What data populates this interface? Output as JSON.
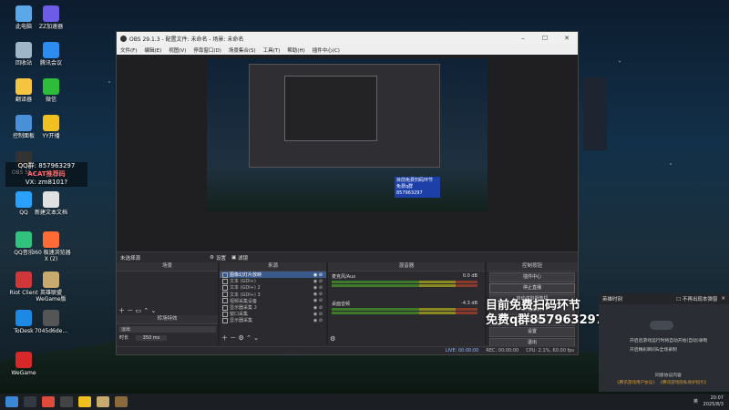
{
  "desktop_icons": [
    {
      "label": "此电脑",
      "color": "#5ba7e8"
    },
    {
      "label": "ZZ加速器",
      "color": "#6c5ce7"
    },
    {
      "label": "回收站",
      "color": "#9fb6c9"
    },
    {
      "label": "腾讯会议",
      "color": "#2d8cf0"
    },
    {
      "label": "翻译器",
      "color": "#f5c542"
    },
    {
      "label": "微信",
      "color": "#2dbd3a"
    },
    {
      "label": "控制面板",
      "color": "#4a90d9"
    },
    {
      "label": "YY开播",
      "color": "#f0c020"
    },
    {
      "label": "OBS St...",
      "color": "#333"
    },
    {
      "label": "QQ",
      "color": "#2aa1ff"
    },
    {
      "label": "新建文本文档",
      "color": "#e0e0e0"
    },
    {
      "label": "QQ音乐",
      "color": "#31c27c"
    },
    {
      "label": "360 极速浏览器X (2)",
      "color": "#ff6b35"
    },
    {
      "label": "Riot Client",
      "color": "#d13639"
    },
    {
      "label": "英雄联盟WeGame版",
      "color": "#c8aa6e"
    },
    {
      "label": "ToDesk",
      "color": "#1e88e5"
    },
    {
      "label": "7045d6de...",
      "color": "#555"
    },
    {
      "label": "WeGame",
      "color": "#d62828"
    }
  ],
  "watermark_text": [
    "QQ群: 857963297",
    "ACAT推荐码",
    "VX: zm8101?"
  ],
  "obs": {
    "title": "OBS 29.1.3 - 配置文件: 未命名 - 场景: 未命名",
    "menu": [
      "文件(F)",
      "编辑(E)",
      "视图(V)",
      "停靠窗口(D)",
      "场景集合(S)",
      "工具(T)",
      "帮助(H)",
      "插件中心(C)"
    ],
    "preview_note": "目前免费扫码环节 免费q群857963297",
    "scene_bar": {
      "name": "未选择源",
      "settings": "设置",
      "filters": "滤镜"
    },
    "docks": {
      "scenes": "场景",
      "sources": "来源",
      "mixer": "混音器",
      "controls": "控制按钮",
      "transitions": "转场特效"
    },
    "sources": [
      {
        "name": "图像幻灯片放映",
        "selected": true
      },
      {
        "name": "文本 (GDI+)",
        "selected": false
      },
      {
        "name": "文本 (GDI+) 2",
        "selected": false
      },
      {
        "name": "文本 (GDI+) 3",
        "selected": false
      },
      {
        "name": "视频采集设备",
        "selected": false
      },
      {
        "name": "显示器采集 2",
        "selected": false
      },
      {
        "name": "窗口采集",
        "selected": false
      },
      {
        "name": "显示器采集",
        "selected": false
      }
    ],
    "mixer": [
      {
        "name": "麦克风/Aux",
        "db": "0.0 dB"
      },
      {
        "name": "桌面音频",
        "db": "-4.3 dB"
      }
    ],
    "transitions": {
      "name": "淡出",
      "duration_label": "时长",
      "duration": "350 ms"
    },
    "controls": [
      "插件中心",
      "停止直播",
      "启动虚拟摄像机",
      "开始录制",
      "工作室模式",
      "设置",
      "退出"
    ],
    "status": {
      "live": "LIVE: 00:00:00",
      "rec": "REC: 00:00:00",
      "cpu": "CPU: 2.1%, 60.00 fps"
    }
  },
  "overlay": [
    "目前免费扫码环节",
    "免费q群857963297"
  ],
  "notif_panel": {
    "title": "英雄时刻",
    "dont_remind": "不再出现本弹窗",
    "line1": "开启后游戏运行时将自动开始(自动)录制",
    "line2": "开启精彩瞬间&全场录制",
    "agree": "同意协议内容",
    "links": "《腾讯游戏用户协议》 《腾讯游戏隐私保护指引》"
  },
  "tray": {
    "time": "20:07",
    "date": "2025/8/3",
    "ime": "英"
  }
}
